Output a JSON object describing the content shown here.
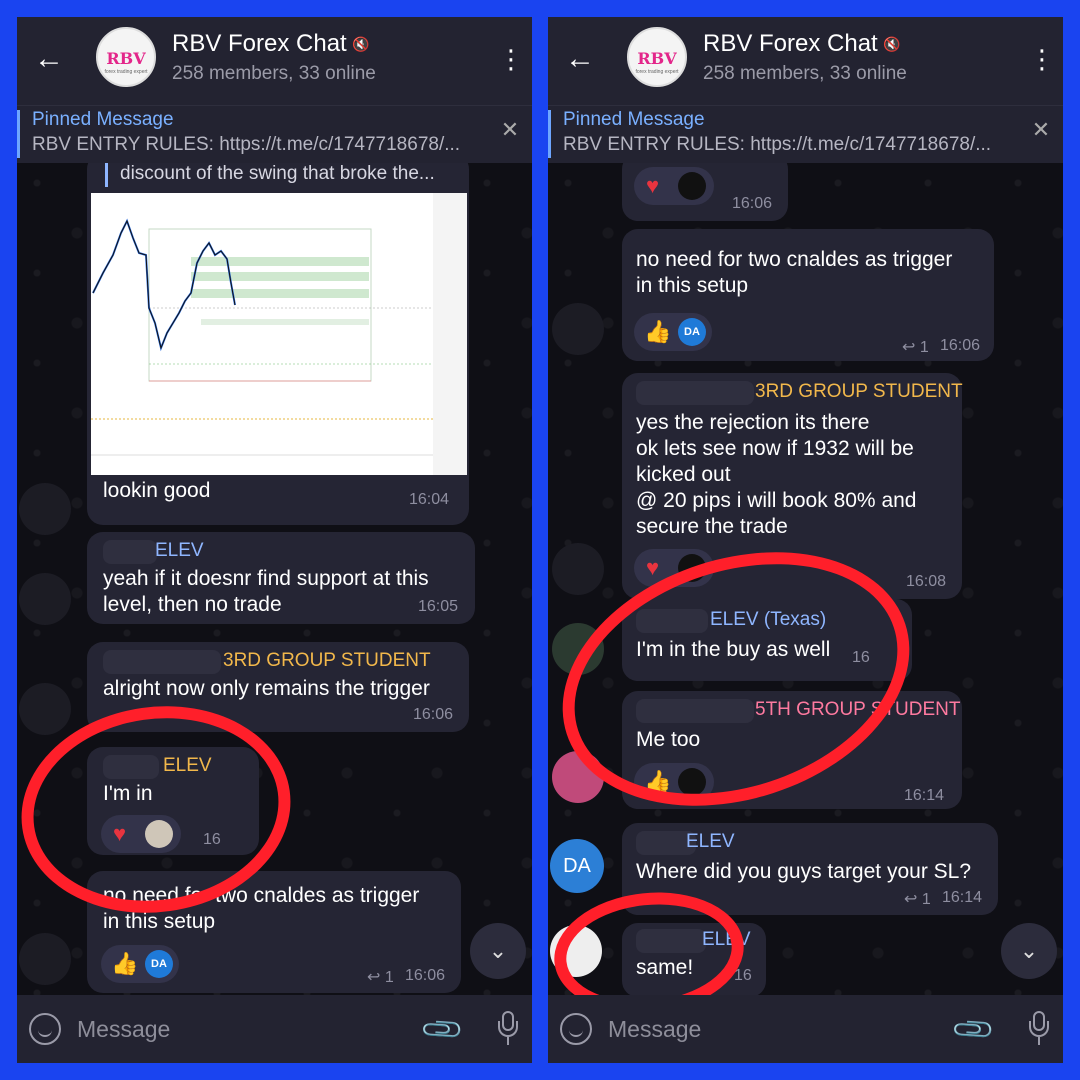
{
  "header": {
    "title": "RBV Forex Chat",
    "subtitle": "258 members, 33 online",
    "logo_text": "RBV",
    "logo_sub": "forex trading expert"
  },
  "pinned": {
    "title": "Pinned Message",
    "text": "RBV ENTRY RULES: https://t.me/c/1747718678/..."
  },
  "input": {
    "placeholder": "Message"
  },
  "left": {
    "reply_quote": "discount of the swing that broke the...",
    "messages": [
      {
        "text": "lookin good",
        "time": "16:04"
      },
      {
        "name": "ELEV",
        "lines": [
          "yeah if it doesnr find support at this",
          "level, then no trade"
        ],
        "time": "16:05"
      },
      {
        "name": "3RD GROUP STUDENT",
        "lines": [
          "alright now only remains the trigger"
        ],
        "time": "16:06"
      },
      {
        "name": "ELEV",
        "lines": [
          "I'm in"
        ],
        "time": "16"
      },
      {
        "lines": [
          "no need for two cnaldes as trigger",
          "in this setup"
        ],
        "replies": "1",
        "time": "16:06",
        "react_av": "DA"
      }
    ]
  },
  "right": {
    "messages": [
      {
        "time": "16:06"
      },
      {
        "lines": [
          "no need for two cnaldes as trigger",
          "in this setup"
        ],
        "replies": "1",
        "time": "16:06",
        "react_av": "DA"
      },
      {
        "name": "3RD GROUP STUDENT",
        "lines": [
          "yes the rejection its there",
          "ok lets see now if 1932 will be",
          "kicked out",
          "@ 20 pips i will book 80% and",
          "secure the trade"
        ],
        "time": "16:08"
      },
      {
        "name": "ELEV (Texas)",
        "lines": [
          "I'm in the buy as well"
        ],
        "time": "16"
      },
      {
        "name": "5TH GROUP STUDENT",
        "lines": [
          "Me too"
        ],
        "time": "16:14"
      },
      {
        "name": "ELEV",
        "lines": [
          "Where did you guys target your SL?"
        ],
        "replies": "1",
        "time": "16:14",
        "avatar": "DA"
      },
      {
        "name": "ELEV",
        "lines": [
          "same!"
        ],
        "time": "16"
      }
    ]
  },
  "icons": {
    "back": "arrow-left-icon",
    "menu": "more-vertical-icon",
    "close": "close-icon",
    "mute": "mute-icon",
    "emoji": "smile-icon",
    "attach": "paperclip-icon",
    "mic": "microphone-icon",
    "scroll": "chevron-down-icon",
    "heart": "heart-icon",
    "thumb": "thumbs-up-icon"
  },
  "colors": {
    "frame": "#1a44f0",
    "bubble": "#252534",
    "name_gold": "#f2b84b",
    "name_blue": "#8fb6ff",
    "name_pink": "#ff7aa0",
    "annotation_red": "#ff1f2a"
  }
}
